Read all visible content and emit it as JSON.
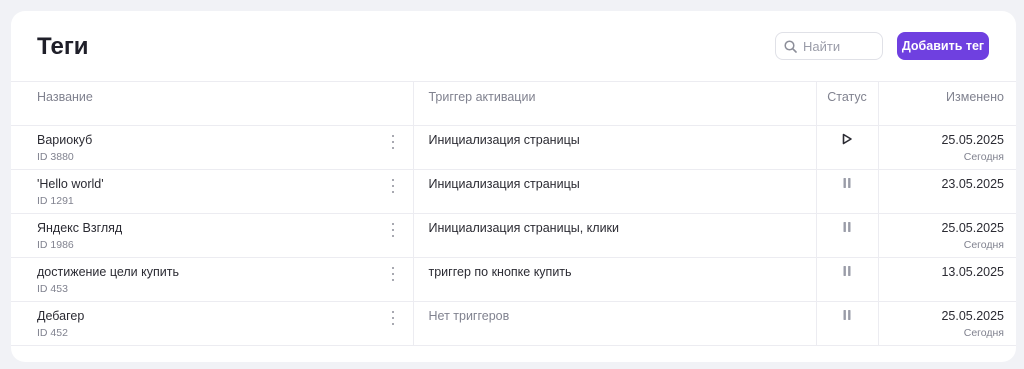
{
  "page": {
    "title": "Теги"
  },
  "search": {
    "placeholder": "Найти",
    "value": ""
  },
  "actions": {
    "add_tag_label": "Добавить тег",
    "accent_color": "#6f40e0"
  },
  "table": {
    "columns": {
      "name": "Название",
      "trigger": "Триггер активации",
      "status": "Статус",
      "modified": "Изменено"
    },
    "rows": [
      {
        "name": "Вариокуб",
        "id": "ID 3880",
        "trigger": "Инициализация страницы",
        "trigger_muted": false,
        "status": "play-icon",
        "date": "25.05.2025",
        "relative": "Сегодня"
      },
      {
        "name": "'Hello world'",
        "id": "ID 1291",
        "trigger": "Инициализация страницы",
        "trigger_muted": false,
        "status": "pause-icon",
        "date": "23.05.2025",
        "relative": ""
      },
      {
        "name": "Яндекс Взгляд",
        "id": "ID 1986",
        "trigger": "Инициализация страницы, клики",
        "trigger_muted": false,
        "status": "pause-icon",
        "date": "25.05.2025",
        "relative": "Сегодня"
      },
      {
        "name": "достижение цели купить",
        "id": "ID 453",
        "trigger": "триггер по кнопке купить",
        "trigger_muted": false,
        "status": "pause-icon",
        "date": "13.05.2025",
        "relative": ""
      },
      {
        "name": "Дебагер",
        "id": "ID 452",
        "trigger": "Нет триггеров",
        "trigger_muted": true,
        "status": "pause-icon",
        "date": "25.05.2025",
        "relative": "Сегодня"
      }
    ]
  }
}
